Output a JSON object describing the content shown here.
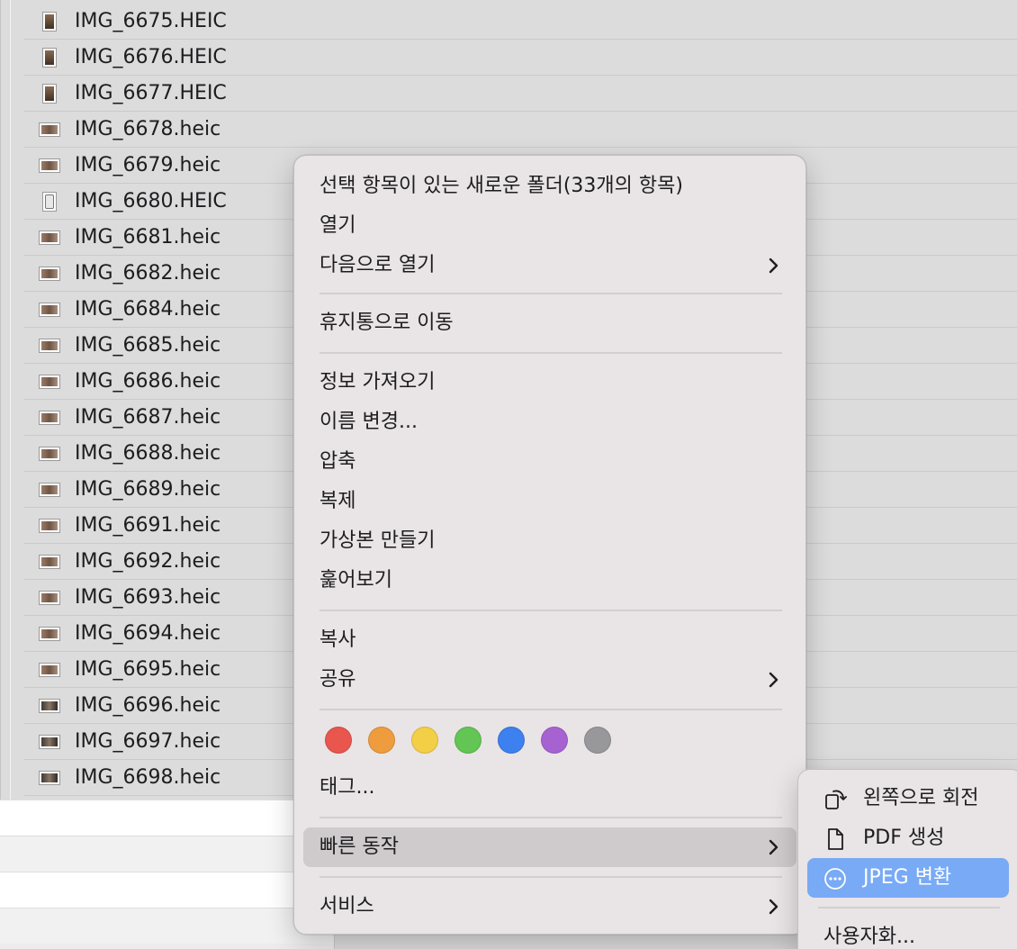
{
  "files": [
    {
      "name": "IMG_6675.HEIC",
      "thumb": "portrait"
    },
    {
      "name": "IMG_6676.HEIC",
      "thumb": "portrait"
    },
    {
      "name": "IMG_6677.HEIC",
      "thumb": "portrait"
    },
    {
      "name": "IMG_6678.heic",
      "thumb": "landscape"
    },
    {
      "name": "IMG_6679.heic",
      "thumb": "landscape"
    },
    {
      "name": "IMG_6680.HEIC",
      "thumb": "portrait-blank"
    },
    {
      "name": "IMG_6681.heic",
      "thumb": "landscape"
    },
    {
      "name": "IMG_6682.heic",
      "thumb": "landscape"
    },
    {
      "name": "IMG_6684.heic",
      "thumb": "landscape"
    },
    {
      "name": "IMG_6685.heic",
      "thumb": "landscape"
    },
    {
      "name": "IMG_6686.heic",
      "thumb": "landscape"
    },
    {
      "name": "IMG_6687.heic",
      "thumb": "landscape"
    },
    {
      "name": "IMG_6688.heic",
      "thumb": "landscape"
    },
    {
      "name": "IMG_6689.heic",
      "thumb": "landscape"
    },
    {
      "name": "IMG_6691.heic",
      "thumb": "landscape"
    },
    {
      "name": "IMG_6692.heic",
      "thumb": "landscape"
    },
    {
      "name": "IMG_6693.heic",
      "thumb": "landscape"
    },
    {
      "name": "IMG_6694.heic",
      "thumb": "landscape"
    },
    {
      "name": "IMG_6695.heic",
      "thumb": "landscape"
    },
    {
      "name": "IMG_6696.heic",
      "thumb": "landscape-dark"
    },
    {
      "name": "IMG_6697.heic",
      "thumb": "landscape-dark"
    },
    {
      "name": "IMG_6698.heic",
      "thumb": "landscape-dark"
    }
  ],
  "context_menu": {
    "new_folder": "선택 항목이 있는 새로운 폴더(33개의 항목)",
    "open": "열기",
    "open_with": "다음으로 열기",
    "move_to_trash": "휴지통으로 이동",
    "get_info": "정보 가져오기",
    "rename": "이름 변경...",
    "compress": "압축",
    "duplicate": "복제",
    "make_alias": "가상본 만들기",
    "quick_look": "훑어보기",
    "copy": "복사",
    "share": "공유",
    "tags": "태그...",
    "quick_actions": "빠른 동작",
    "services": "서비스",
    "tag_colors": [
      "#e8564e",
      "#ee9c3e",
      "#f3cf47",
      "#62c554",
      "#3d80ef",
      "#a762d2",
      "#98989b"
    ],
    "tag_color_names": [
      "red",
      "orange",
      "yellow",
      "green",
      "blue",
      "purple",
      "gray"
    ]
  },
  "quick_actions_menu": {
    "rotate_left": "왼쪽으로 회전",
    "create_pdf": "PDF 생성",
    "convert_jpeg": "JPEG 변환",
    "customize": "사용자화..."
  },
  "colors": {
    "menu_bg": "#e9e4e5",
    "highlight": "#cfcacc",
    "selected_accent": "#78aaf5"
  }
}
